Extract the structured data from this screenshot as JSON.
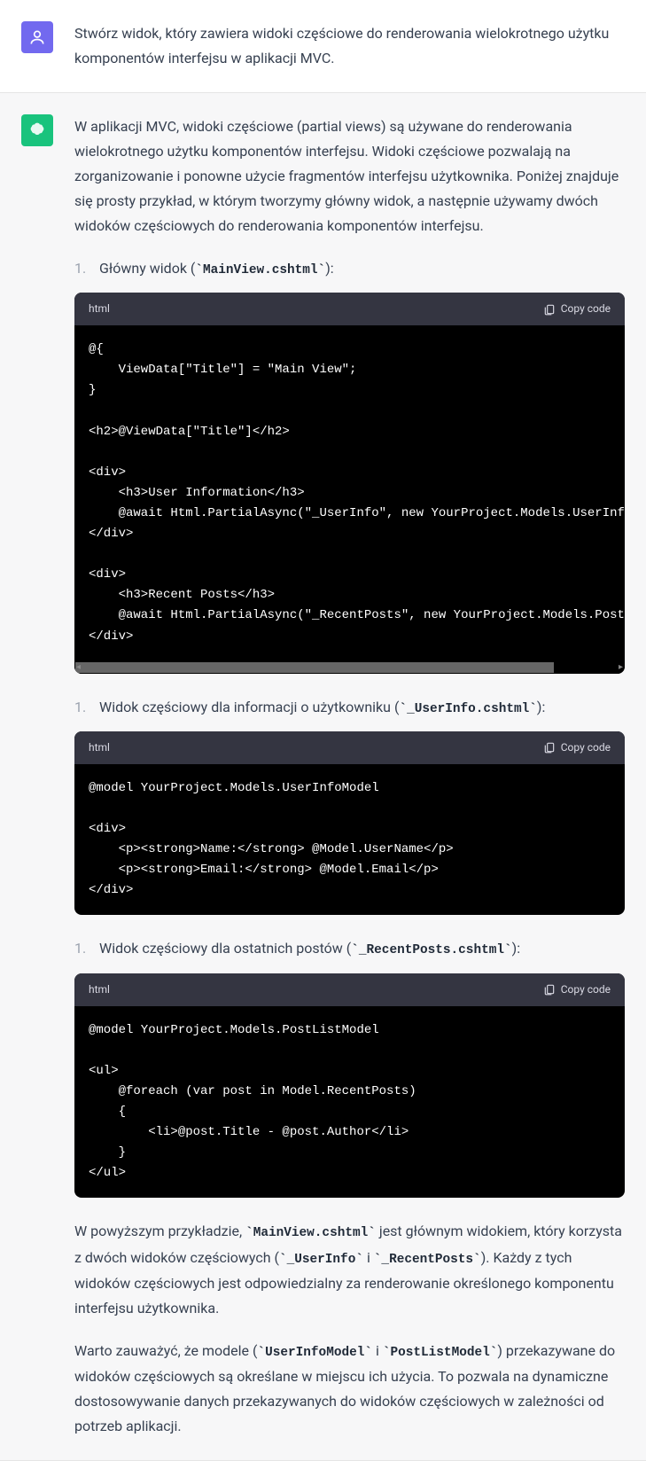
{
  "user": {
    "text": "Stwórz widok, który zawiera widoki częściowe do renderowania wielokrotnego użytku komponentów interfejsu w aplikacji MVC."
  },
  "assistant": {
    "intro": "W aplikacji MVC, widoki częściowe (partial views) są używane do renderowania wielokrotnego użytku komponentów interfejsu. Widoki częściowe pozwalają na zorganizowanie i ponowne użycie fragmentów interfejsu użytkownika. Poniżej znajduje się prosty przykład, w którym tworzymy główny widok, a następnie używamy dwóch widoków częściowych do renderowania komponentów interfejsu.",
    "item1_prefix": "Główny widok (",
    "item1_code": "`MainView.cshtml`",
    "item1_suffix": "):",
    "item2_prefix": "Widok częściowy dla informacji o użytkowniku (",
    "item2_code": "`_UserInfo.cshtml`",
    "item2_suffix": "):",
    "item3_prefix": "Widok częściowy dla ostatnich postów (",
    "item3_code": "`_RecentPosts.cshtml`",
    "item3_suffix": "):",
    "code_lang": "html",
    "copy_label": "Copy code",
    "code1": "@{\n    ViewData[\"Title\"] = \"Main View\";\n}\n\n<h2>@ViewData[\"Title\"]</h2>\n\n<div>\n    <h3>User Information</h3>\n    @await Html.PartialAsync(\"_UserInfo\", new YourProject.Models.UserInfoModel { UserName = \"John\", Email = \"john@example.com\" })\n</div>\n\n<div>\n    <h3>Recent Posts</h3>\n    @await Html.PartialAsync(\"_RecentPosts\", new YourProject.Models.PostListModel { RecentPosts = posts })\n</div>",
    "code2": "@model YourProject.Models.UserInfoModel\n\n<div>\n    <p><strong>Name:</strong> @Model.UserName</p>\n    <p><strong>Email:</strong> @Model.Email</p>\n</div>",
    "code3": "@model YourProject.Models.PostListModel\n\n<ul>\n    @foreach (var post in Model.RecentPosts)\n    {\n        <li>@post.Title - @post.Author</li>\n    }\n</ul>",
    "outro1_a": "W powyższym przykładzie, ",
    "outro1_code1": "`MainView.cshtml`",
    "outro1_b": " jest głównym widokiem, który korzysta z dwóch widoków częściowych (",
    "outro1_code2": "`_UserInfo`",
    "outro1_c": " i ",
    "outro1_code3": "`_RecentPosts`",
    "outro1_d": "). Każdy z tych widoków częściowych jest odpowiedzialny za renderowanie określonego komponentu interfejsu użytkownika.",
    "outro2_a": "Warto zauważyć, że modele (",
    "outro2_code1": "`UserInfoModel`",
    "outro2_b": " i ",
    "outro2_code2": "`PostListModel`",
    "outro2_c": ") przekazywane do widoków częściowych są określane w miejscu ich użycia. To pozwala na dynamiczne dostosowywanie danych przekazywanych do widoków częściowych w zależności od potrzeb aplikacji."
  }
}
